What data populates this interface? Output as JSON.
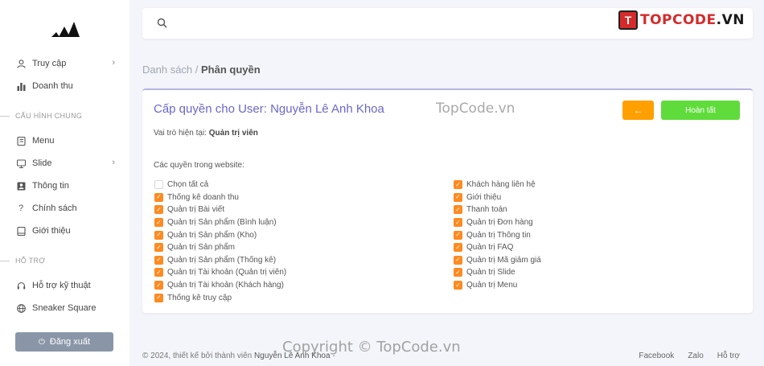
{
  "sidebar": {
    "items_top": [
      {
        "label": "Truy cập",
        "icon": "user-icon",
        "chevron": "›"
      },
      {
        "label": "Doanh thu",
        "icon": "bar-chart-icon"
      }
    ],
    "section_general": "CẤU HÌNH CHUNG",
    "items_general": [
      {
        "label": "Menu",
        "icon": "book-icon"
      },
      {
        "label": "Slide",
        "icon": "monitor-icon",
        "chevron": "›"
      },
      {
        "label": "Thông tin",
        "icon": "contact-card-icon"
      },
      {
        "label": "Chính sách",
        "icon": "question-icon"
      },
      {
        "label": "Giới thiệu",
        "icon": "tablet-icon"
      }
    ],
    "section_support": "HỖ TRỢ",
    "items_support": [
      {
        "label": "Hỗ trợ kỹ thuật",
        "icon": "headset-icon"
      },
      {
        "label": "Sneaker Square",
        "icon": "globe-icon"
      }
    ],
    "logout_label": "Đăng xuất"
  },
  "brand": {
    "badge": "T",
    "text_red": "TOPCODE",
    "text_dark": ".VN"
  },
  "breadcrumb": {
    "parent": "Danh sách",
    "separator": " / ",
    "current": "Phân quyền"
  },
  "card": {
    "title": "Cấp quyền cho User: Nguyễn Lê Anh Khoa",
    "role_label": "Vai trò hiện tại:",
    "role_value": "Quản trị viên",
    "back_icon": "←",
    "done_label": "Hoàn tất",
    "perm_label": "Các quyền trong website:",
    "watermark": "TopCode.vn"
  },
  "permissions_left": [
    {
      "label": "Chọn tất cả",
      "checked": false
    },
    {
      "label": "Thống kê doanh thu",
      "checked": true
    },
    {
      "label": "Quản trị Bài viết",
      "checked": true
    },
    {
      "label": "Quản trị Sản phẩm (Bình luận)",
      "checked": true
    },
    {
      "label": "Quản trị Sản phẩm (Kho)",
      "checked": true
    },
    {
      "label": "Quản trị Sản phẩm",
      "checked": true
    },
    {
      "label": "Quản trị Sản phẩm (Thống kê)",
      "checked": true
    },
    {
      "label": "Quản trị Tài khoản (Quản trị viên)",
      "checked": true
    },
    {
      "label": "Quản trị Tài khoản (Khách hàng)",
      "checked": true
    },
    {
      "label": "Thống kê truy cập",
      "checked": true
    }
  ],
  "permissions_right": [
    {
      "label": "Khách hàng liên hệ",
      "checked": true
    },
    {
      "label": "Giới thiệu",
      "checked": true
    },
    {
      "label": "Thanh toán",
      "checked": true
    },
    {
      "label": "Quản trị Đơn hàng",
      "checked": true
    },
    {
      "label": "Quản trị Thông tin",
      "checked": true
    },
    {
      "label": "Quản trị FAQ",
      "checked": true
    },
    {
      "label": "Quản trị Mã giảm giá",
      "checked": true
    },
    {
      "label": "Quản trị Slide",
      "checked": true
    },
    {
      "label": "Quản trị Menu",
      "checked": true
    }
  ],
  "footer": {
    "prefix": "© 2024, thiết kế bởi thành viên",
    "author": "Nguyễn Lê Anh Khoa",
    "suffix": " -",
    "links": [
      "Facebook",
      "Zalo",
      "Hỗ trợ"
    ],
    "watermark": "Copyright © TopCode.vn"
  },
  "colors": {
    "accent": "#6b67c9",
    "checkbox": "#ff8a1f",
    "back_button": "#ff9f00",
    "done_button": "#5fdc3b",
    "logout": "#8a96a8"
  }
}
